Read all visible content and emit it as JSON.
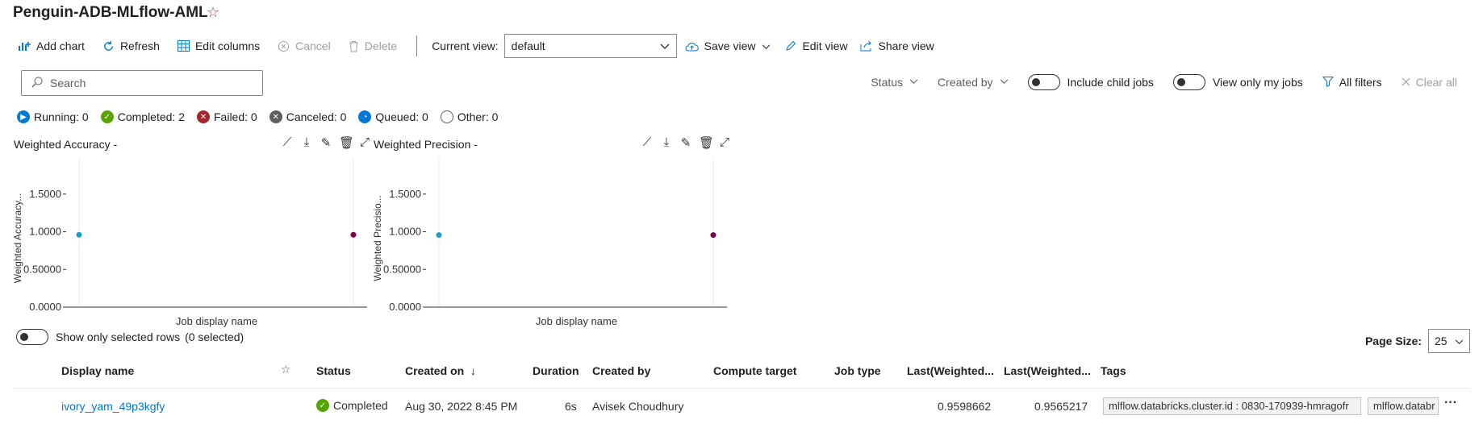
{
  "page": {
    "title": "Penguin-ADB-MLflow-AML"
  },
  "toolbar": {
    "add_chart": "Add chart",
    "refresh": "Refresh",
    "edit_columns": "Edit columns",
    "cancel": "Cancel",
    "delete": "Delete",
    "current_view_label": "Current view:",
    "current_view_value": "default",
    "save_view": "Save view",
    "edit_view": "Edit view",
    "share_view": "Share view"
  },
  "search": {
    "placeholder": "Search"
  },
  "filters": {
    "status": "Status",
    "created_by": "Created by",
    "include_child_jobs": "Include child jobs",
    "view_only_my_jobs": "View only my jobs",
    "all_filters": "All filters",
    "clear_all": "Clear all"
  },
  "status_counts": {
    "running": "Running: 0",
    "completed": "Completed: 2",
    "failed": "Failed: 0",
    "canceled": "Canceled: 0",
    "queued": "Queued: 0",
    "other": "Other: 0"
  },
  "colors": {
    "accent": "#0078d4",
    "completed": "#57a300",
    "failed": "#a4262c",
    "canceled": "#605e5c",
    "point_a": "#1b9ec2",
    "point_b": "#7a0050"
  },
  "chart_data": [
    {
      "type": "scatter",
      "title": "Weighted Accuracy -",
      "xlabel": "Job display name",
      "ylabel": "Weighted Accuracy...",
      "ylim": [
        0,
        2
      ],
      "yticks": [
        "0.0000",
        "0.50000",
        "1.0000",
        "1.5000"
      ],
      "ytick_values": [
        0,
        0.5,
        1,
        1.5
      ],
      "points": [
        {
          "x": 0,
          "y": 0.9598662,
          "color": "#1b9ec2"
        },
        {
          "x": 1,
          "y": 0.9598662,
          "color": "#7a0050"
        }
      ]
    },
    {
      "type": "scatter",
      "title": "Weighted Precision -",
      "xlabel": "Job display name",
      "ylabel": "Weighted Precisio...",
      "ylim": [
        0,
        2
      ],
      "yticks": [
        "0.0000",
        "0.50000",
        "1.0000",
        "1.5000"
      ],
      "ytick_values": [
        0,
        0.5,
        1,
        1.5
      ],
      "points": [
        {
          "x": 0,
          "y": 0.9565217,
          "color": "#1b9ec2"
        },
        {
          "x": 1,
          "y": 0.9565217,
          "color": "#7a0050"
        }
      ]
    }
  ],
  "show_selected": {
    "label": "Show only selected rows",
    "count": "(0 selected)"
  },
  "page_size": {
    "label": "Page Size:",
    "value": "25"
  },
  "table": {
    "headers": {
      "display_name": "Display name",
      "status": "Status",
      "created_on": "Created on",
      "duration": "Duration",
      "created_by": "Created by",
      "compute_target": "Compute target",
      "job_type": "Job type",
      "last_weighted_1": "Last(Weighted...",
      "last_weighted_2": "Last(Weighted...",
      "tags": "Tags"
    },
    "rows": [
      {
        "display_name": "ivory_yam_49p3kgfy",
        "status": "Completed",
        "created_on": "Aug 30, 2022 8:45 PM",
        "duration": "6s",
        "created_by": "Avisek Choudhury",
        "compute_target": "",
        "job_type": "",
        "last_weighted_1": "0.9598662",
        "last_weighted_2": "0.9565217",
        "tag_1": "mlflow.databricks.cluster.id : 0830-170939-hmragofr",
        "tag_2": "mlflow.databr"
      }
    ]
  }
}
